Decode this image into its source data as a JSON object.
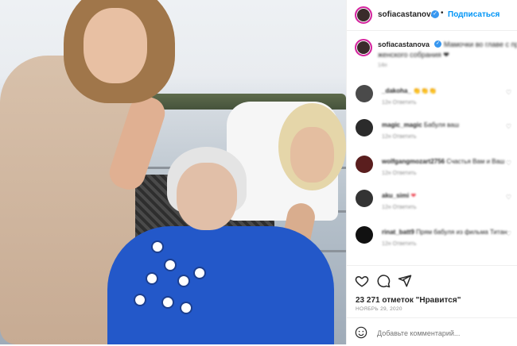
{
  "header": {
    "username": "sofiacastanova",
    "separator": "•",
    "follow_label": "Подписаться"
  },
  "caption": {
    "username": "sofiacastanova",
    "text": "Мамочки во главе с пра",
    "text2": "женского собрания ❤",
    "time": "14н"
  },
  "comments": [
    {
      "username": "_dakoha_",
      "text": "👏👏👏",
      "meta": "12н  Ответить"
    },
    {
      "username": "magic_magic",
      "text": "Бабуля ваш",
      "meta": "12н  Ответить"
    },
    {
      "username": "wolfgangmozart2756",
      "text": "Счастья Вам и Ваш",
      "meta": "12н  Ответить"
    },
    {
      "username": "aku_simi",
      "text": "❤",
      "meta": "12н  Ответить"
    },
    {
      "username": "rinat_batt9",
      "text": "Прям бабуля из фильма Титан",
      "meta": "12н  Ответить"
    }
  ],
  "icons": {
    "like": "heart-icon",
    "comment": "comment-icon",
    "share": "share-icon",
    "emoji": "emoji-icon",
    "verified": "verified-icon"
  },
  "likes": "23 271 отметок \"Нравится\"",
  "date": "НОЯБРЬ 29, 2020",
  "add_comment_placeholder": "Добавьте комментарий...",
  "colors": {
    "accent": "#0095f6",
    "verified": "#3897f0",
    "text": "#262626",
    "muted": "#8e8e8e",
    "ring": "#d6249f"
  }
}
